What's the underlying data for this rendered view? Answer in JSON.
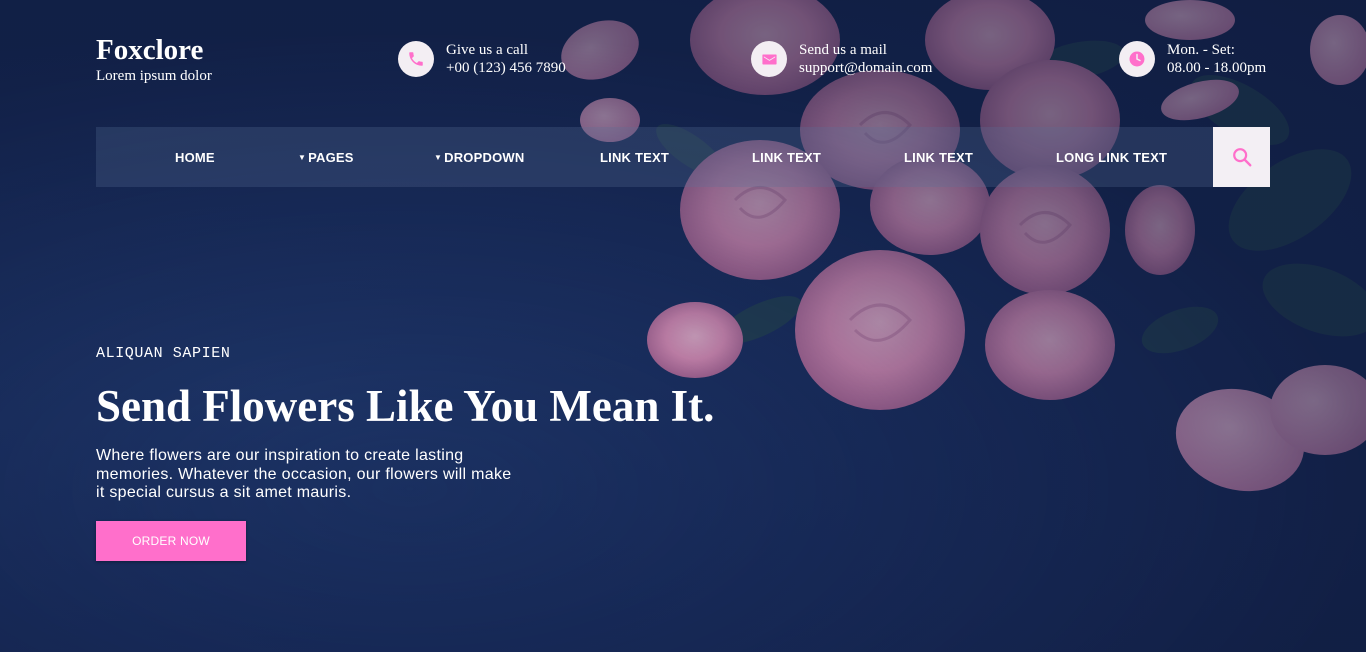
{
  "brand": {
    "name": "Foxclore",
    "tagline": "Lorem ipsum dolor"
  },
  "contact": {
    "call": {
      "icon": "phone-icon",
      "label": "Give us a call",
      "value": "+00 (123) 456 7890"
    },
    "mail": {
      "icon": "mail-icon",
      "label": "Send us a mail",
      "value": "support@domain.com"
    },
    "hours": {
      "icon": "clock-icon",
      "label": "Mon. - Set:",
      "value": "08.00 - 18.00pm"
    }
  },
  "nav": {
    "items": [
      {
        "label": "HOME",
        "dropdown": false
      },
      {
        "label": "PAGES",
        "dropdown": true
      },
      {
        "label": "DROPDOWN",
        "dropdown": true
      },
      {
        "label": "LINK TEXT",
        "dropdown": false
      },
      {
        "label": "LINK TEXT",
        "dropdown": false
      },
      {
        "label": "LINK TEXT",
        "dropdown": false
      },
      {
        "label": "LONG LINK TEXT",
        "dropdown": false
      }
    ],
    "search_icon": "search-icon"
  },
  "hero": {
    "eyebrow": "ALIQUAN SAPIEN",
    "headline": "Send Flowers Like You Mean It.",
    "description": "Where flowers are our inspiration to create lasting memories. Whatever the occasion, our flowers will make it special cursus a sit amet mauris.",
    "cta_label": "ORDER NOW"
  },
  "colors": {
    "accent": "#ff6fcb",
    "background": "#172a58",
    "icon_circle": "#f3eef3"
  }
}
